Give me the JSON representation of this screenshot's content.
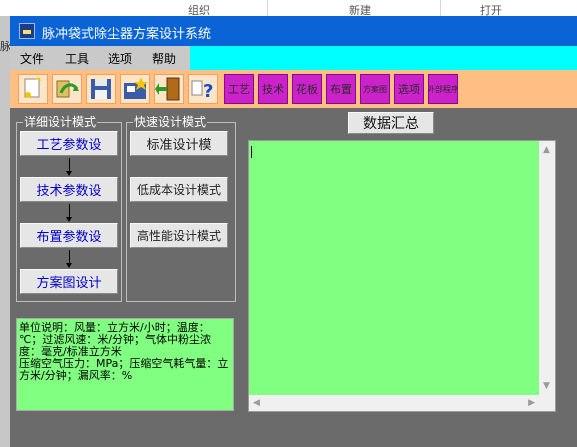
{
  "background": {
    "tab1": "组织",
    "tab2": "新建",
    "tab3": "打开",
    "left_char": "脉"
  },
  "window": {
    "title": "脉冲袋式除尘器方案设计系统"
  },
  "menu": {
    "items": [
      "文件",
      "工具",
      "选项",
      "帮助"
    ]
  },
  "toolbar": {
    "icons": [
      "new-icon",
      "open-icon",
      "save-icon",
      "add-icon",
      "exit-icon",
      "help-icon"
    ],
    "text_buttons": [
      "工艺",
      "技术",
      "花板",
      "布置",
      "方案图",
      "选项",
      "外部程序"
    ]
  },
  "detail_group": {
    "title": "详细设计模式",
    "buttons": [
      "工艺参数设",
      "技术参数设",
      "布置参数设",
      "方案图设计"
    ]
  },
  "quick_group": {
    "title": "快速设计模式",
    "buttons": [
      "标准设计模",
      "低成本设计模式",
      "高性能设计模式"
    ]
  },
  "note": {
    "lines": [
      "单位说明：风量：立方米/小时；温度：℃；过滤风速：米/分钟；气体中粉尘浓度：毫克/标准立方米",
      "压缩空气压力：MPa；压缩空气耗气量：立方米/分钟；漏风率：%"
    ]
  },
  "summary": {
    "label": "数据汇总",
    "text": ""
  },
  "colors": {
    "title_bar": "#0a64d6",
    "menu_bar": "#00ffff",
    "toolbar": "#ffbf82",
    "panel_green": "#80ff80",
    "text_button_bg": "#cc22cc"
  }
}
